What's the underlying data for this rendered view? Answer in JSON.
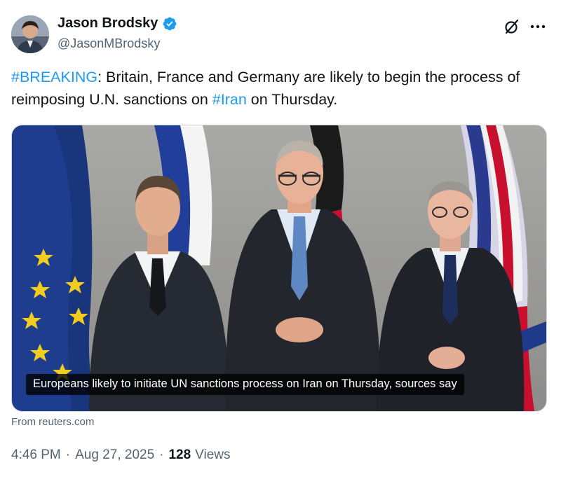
{
  "author": {
    "display_name": "Jason Brodsky",
    "handle": "@JasonMBrodsky",
    "verified": true,
    "verified_color": "#1d9bf0"
  },
  "header_icons": [
    "grok-icon",
    "more-icon"
  ],
  "tweet": {
    "hashtag_breaking": "#BREAKING",
    "text_part1": ": Britain, France and Germany are likely to begin the process of reimposing U.N. sanctions on ",
    "hashtag_iran": "#Iran",
    "text_part2": " on Thursday.",
    "link_color": "#1d9bf0"
  },
  "media": {
    "caption": "Europeans likely to initiate UN sanctions process on Iran on Thursday, sources say",
    "source": "From reuters.com"
  },
  "meta": {
    "time": "4:46 PM",
    "separator": "·",
    "date": "Aug 27, 2025",
    "views_count": "128",
    "views_label": "Views"
  }
}
